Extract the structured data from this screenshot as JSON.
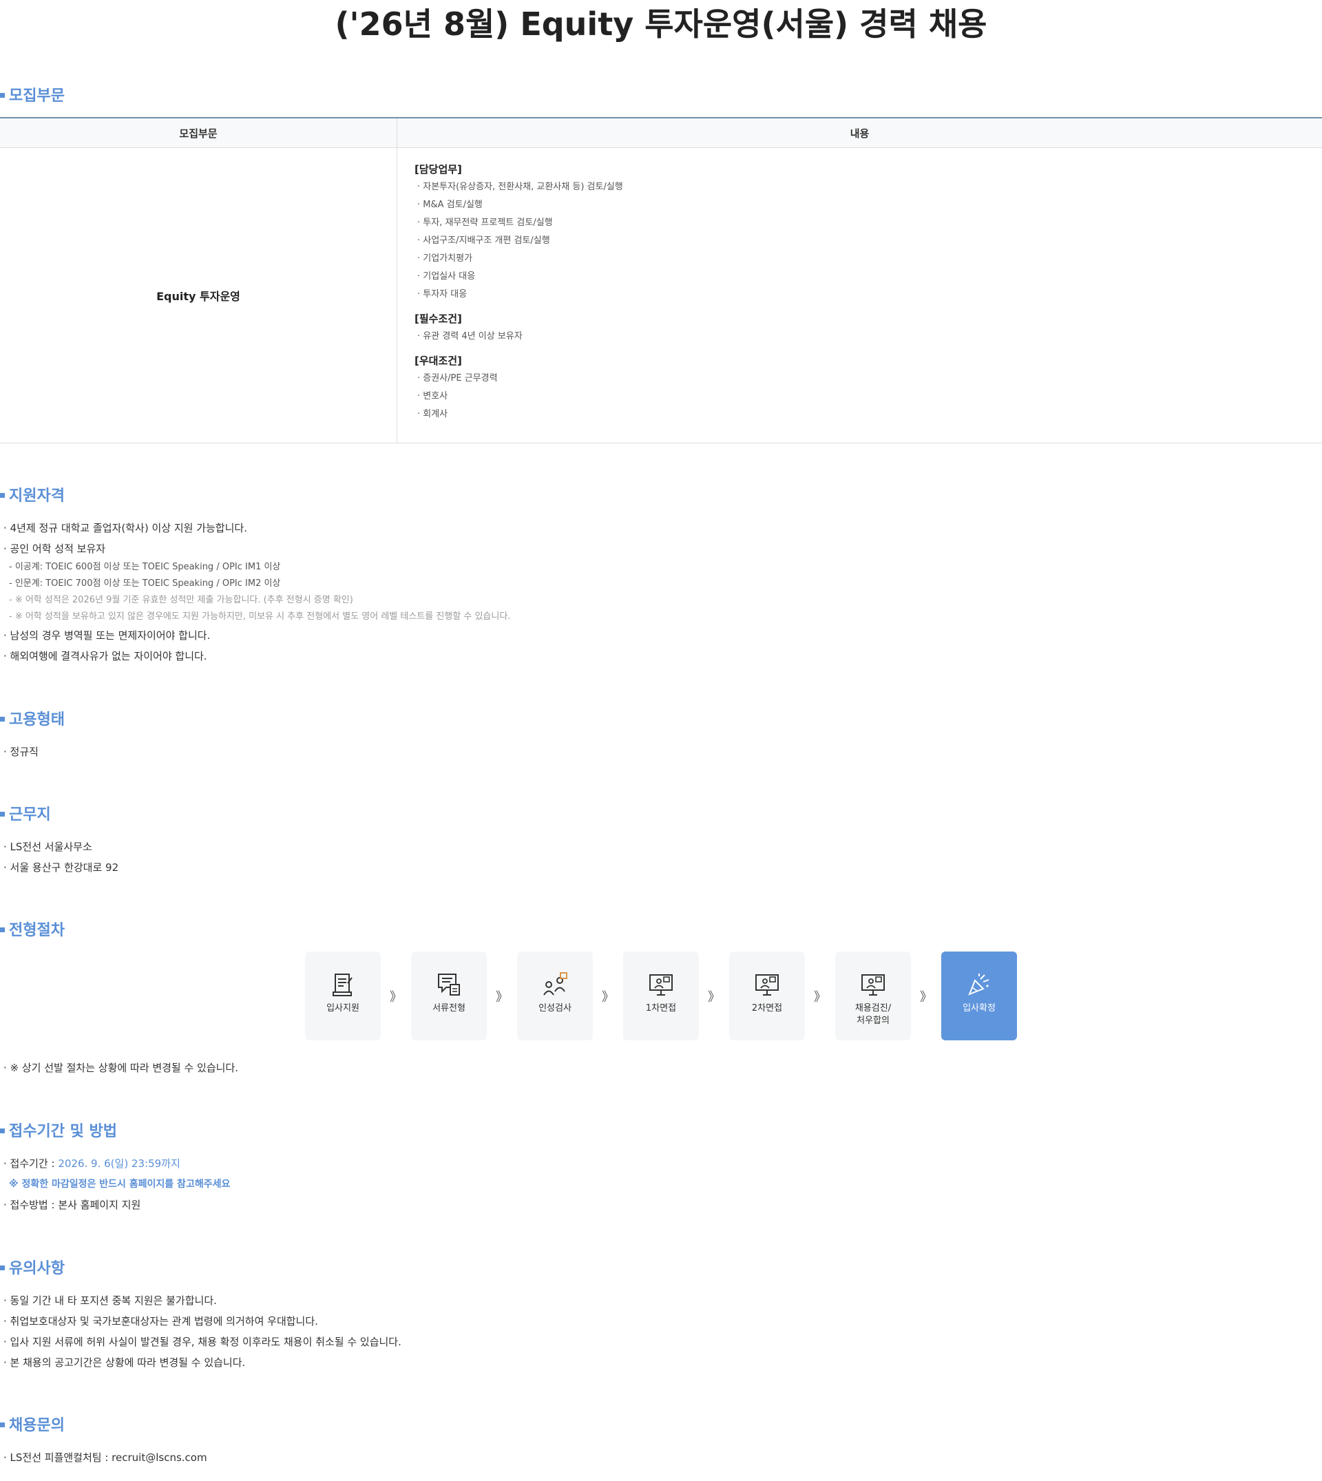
{
  "title": "('26년 8월) Equity 투자운영(서울) 경력 채용",
  "sections": {
    "recruit": "모집부문",
    "qualification": "지원자격",
    "employment": "고용형태",
    "location": "근무지",
    "process": "전형절차",
    "application": "접수기간 및 방법",
    "notes": "유의사항",
    "contact": "채용문의"
  },
  "table": {
    "head": [
      "모집부문",
      "내용"
    ],
    "division": "Equity 투자운영",
    "groups": [
      {
        "title": "[담당업무]",
        "items": [
          "· 자본투자(유상증자, 전환사채, 교환사채 등) 검토/실행",
          "· M&A 검토/실행",
          "· 투자, 재무전략 프로젝트 검토/실행",
          "· 사업구조/지배구조 개편 검토/실행",
          "· 기업가치평가",
          "· 기업실사 대응",
          "· 투자자 대응"
        ]
      },
      {
        "title": "[필수조건]",
        "items": [
          "· 유관 경력 4년 이상 보유자"
        ]
      },
      {
        "title": "[우대조건]",
        "items": [
          "· 증권사/PE 근무경력",
          "· 변호사",
          "· 회계사"
        ]
      }
    ]
  },
  "qualification": {
    "l1": "· 4년제 정규 대학교 졸업자(학사) 이상 지원 가능합니다.",
    "l2": "· 공인 어학 성적 보유자",
    "s1": "- 이공계: TOEIC 600점 이상 또는 TOEIC Speaking / OPIc IM1 이상",
    "s2": "- 인문계: TOEIC 700점 이상 또는 TOEIC Speaking / OPIc IM2 이상",
    "s3": "- ※ 어학 성적은 2026년 9월 기준 유효한 성적만 제출 가능합니다. (추후 전형시 증명 확인)",
    "s4": "- ※ 어학 성적을 보유하고 있지 않은 경우에도 지원 가능하지만, 미보유 시 추후 전형에서 별도 영어 레벨 테스트를 진행할 수 있습니다.",
    "l3": "· 남성의 경우 병역필 또는 면제자이어야 합니다.",
    "l4": "· 해외여행에 결격사유가 없는 자이어야 합니다."
  },
  "employment": {
    "l1": "· 정규직"
  },
  "location": {
    "l1": "· LS전선 서울사무소",
    "l2": "· 서울 용산구 한강대로 92"
  },
  "process": {
    "steps": [
      {
        "label": "입사지원",
        "icon": "document-pen-icon"
      },
      {
        "label": "서류전형",
        "icon": "chat-document-icon"
      },
      {
        "label": "인성검사",
        "icon": "people-test-icon"
      },
      {
        "label": "1차면접",
        "icon": "monitor-interview-icon"
      },
      {
        "label": "2차면접",
        "icon": "monitor-interview-icon"
      },
      {
        "label": "채용검진/\n처우합의",
        "icon": "monitor-interview-icon"
      },
      {
        "label": "입사확정",
        "icon": "party-popper-icon"
      }
    ],
    "arrow": "》",
    "note": "· ※ 상기 선발 절차는 상황에 따라 변경될 수 있습니다."
  },
  "application": {
    "period_label": "· 접수기간 : ",
    "period_value": "2026. 9. 6(일) 23:59까지",
    "notice": "※ 정확한 마감일정은 반드시 홈페이지를 참고해주세요",
    "method": "· 접수방법 : 본사 홈페이지 지원"
  },
  "notes": {
    "l1": "· 동일 기간 내 타 포지션 중복 지원은 불가합니다.",
    "l2": "· 취업보호대상자 및 국가보훈대상자는 관계 법령에 의거하여 우대합니다.",
    "l3": "· 입사 지원 서류에 허위 사실이 발견될 경우, 채용 확정 이후라도 채용이 취소될 수 있습니다.",
    "l4": "· 본 채용의 공고기간은 상황에 따라 변경될 수 있습니다."
  },
  "contact": {
    "l1": "· LS전선 피플앤컬처팀 : recruit@lscns.com"
  },
  "colors": {
    "accent": "#5a8fd6",
    "final_step": "#5f95dd",
    "table_top": "#6f8fae"
  }
}
